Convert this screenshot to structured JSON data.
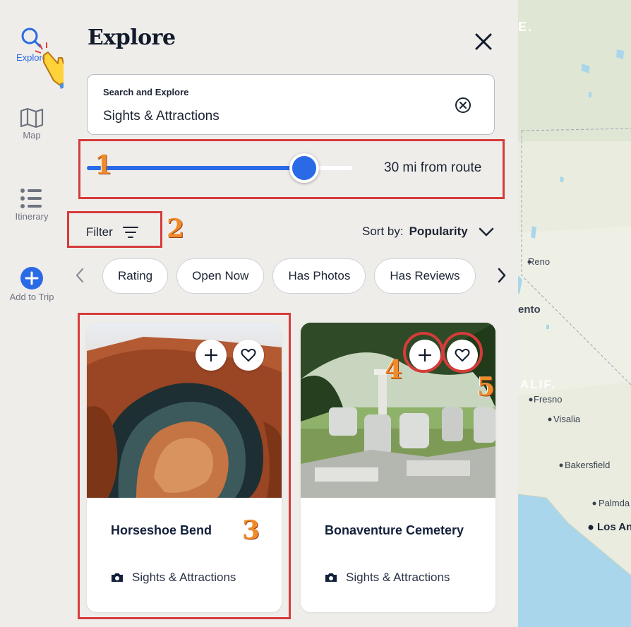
{
  "rail": {
    "items": [
      {
        "label": "Explore",
        "icon": "search-icon",
        "active": true
      },
      {
        "label": "Map",
        "icon": "map-icon"
      },
      {
        "label": "Itinerary",
        "icon": "list-icon"
      },
      {
        "label": "Add to Trip",
        "icon": "plus-circle-icon"
      }
    ]
  },
  "panel": {
    "title": "Explore",
    "search": {
      "label": "Search and Explore",
      "value": "Sights & Attractions"
    },
    "distance": {
      "text": "30 mi from route",
      "level_percent": 82
    },
    "filter_label": "Filter",
    "sort": {
      "prefix": "Sort by:",
      "value": "Popularity"
    },
    "chips": [
      "Rating",
      "Open Now",
      "Has Photos",
      "Has Reviews"
    ],
    "cards": [
      {
        "title": "Horseshoe Bend",
        "category": "Sights & Attractions"
      },
      {
        "title": "Bonaventure Cemetery",
        "category": "Sights & Attractions"
      }
    ]
  },
  "annotations": [
    "1",
    "2",
    "3",
    "4",
    "5"
  ],
  "map": {
    "labels": [
      "E.",
      "Reno",
      "ento",
      "ALIF.",
      "Fresno",
      "Visalia",
      "Bakersfield",
      "Palmda",
      "Los An"
    ]
  },
  "colors": {
    "accent": "#2a6ae6",
    "annotation": "#d63b3b",
    "annotation_number": "#ef8c2a",
    "panel_bg": "#efedea"
  }
}
